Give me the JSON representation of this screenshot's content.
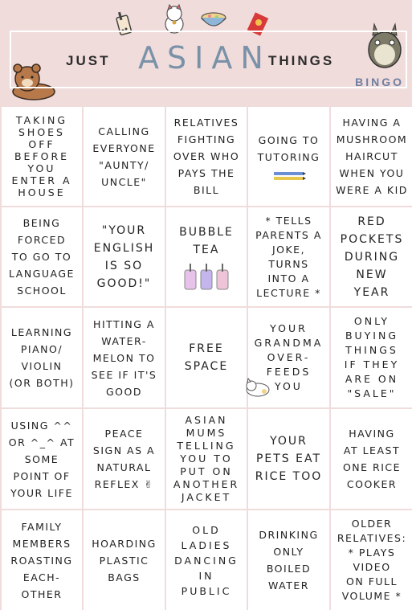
{
  "header": {
    "title_left": "JUST",
    "title_mid": "ASIAN",
    "title_right": "THINGS",
    "subtitle": "BINGO"
  },
  "decorations": [
    "bubble-tea-cup-icon",
    "lucky-cat-icon",
    "noodle-bowl-icon",
    "red-envelope-icon",
    "bear-icon",
    "totoro-icon"
  ],
  "grid": {
    "rows": [
      [
        "TAKING\nSHOES\nOFF\nBEFORE\nYOU\nENTER A\nHOUSE",
        "CALLING\nEVERYONE\n\"AUNTY/\nUNCLE\"",
        "RELATIVES\nFIGHTING\nOVER WHO\nPAYS THE\nBILL",
        "GOING TO\nTUTORING",
        "HAVING A\nMUSHROOM\nHAIRCUT\nWHEN YOU\nWERE A KID"
      ],
      [
        "BEING\nFORCED\nTO GO TO\nLANGUAGE\nSCHOOL",
        "\"YOUR\nENGLISH\nIS SO\nGOOD!\"",
        "BUBBLE\nTEA",
        "* TELLS\nPARENTS A\nJOKE, TURNS\nINTO A\nLECTURE *",
        "RED\nPOCKETS\nDURING\nNEW\nYEAR"
      ],
      [
        "LEARNING\nPIANO/\nVIOLIN\n(OR BOTH)",
        "HITTING A\nWATER-\nMELON TO\nSEE IF IT'S\nGOOD",
        "FREE\nSPACE",
        "YOUR\nGRANDMA\nOVER-\nFEEDS\nYOU",
        "ONLY\nBUYING\nTHINGS\nIF THEY\nARE ON\n\"SALE\""
      ],
      [
        "USING ^^\nOR ^_^ AT\nSOME\nPOINT OF\nYOUR LIFE",
        "PEACE\nSIGN AS A\nNATURAL\nREFLEX ✌",
        "ASIAN\nMUMS\nTELLING\nYOU TO\nPUT ON\nANOTHER\nJACKET",
        "YOUR\nPETS EAT\nRICE TOO",
        "HAVING\nAT LEAST\nONE RICE\nCOOKER"
      ],
      [
        "FAMILY\nMEMBERS\nROASTING\nEACH-\nOTHER",
        "HOARDING\nPLASTIC\nBAGS",
        "OLD\nLADIES\nDANCING\nIN\nPUBLIC",
        "DRINKING\nONLY\nBOILED\nWATER",
        "OLDER\nRELATIVES:\n* PLAYS\nVIDEO\nON FULL\nVOLUME *"
      ]
    ]
  }
}
